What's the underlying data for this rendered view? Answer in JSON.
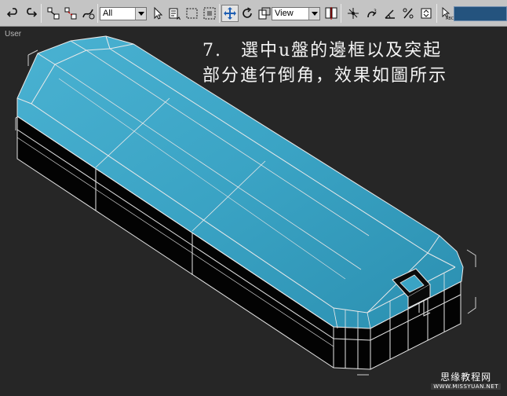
{
  "toolbar": {
    "selection_filter": "All",
    "reference_coord": "View",
    "buttons": [
      {
        "name": "undo-icon",
        "interactable": true
      },
      {
        "name": "redo-icon",
        "interactable": true
      },
      {
        "name": "select-and-link-icon",
        "interactable": true
      },
      {
        "name": "unlink-selection-icon",
        "interactable": true
      },
      {
        "name": "bind-to-space-warp-icon",
        "interactable": true
      },
      {
        "name": "select-object-icon",
        "interactable": true
      },
      {
        "name": "select-by-name-icon",
        "interactable": true
      },
      {
        "name": "rectangular-selection-region-icon",
        "interactable": true
      },
      {
        "name": "window-crossing-icon",
        "interactable": true
      },
      {
        "name": "select-and-move-icon",
        "interactable": true
      },
      {
        "name": "select-and-rotate-icon",
        "interactable": true
      },
      {
        "name": "select-and-scale-icon",
        "interactable": true
      },
      {
        "name": "use-pivot-center-icon",
        "interactable": true
      },
      {
        "name": "select-and-manipulate-icon",
        "interactable": true
      },
      {
        "name": "snaps-toggle-icon",
        "interactable": true
      },
      {
        "name": "angle-snap-icon",
        "interactable": true
      },
      {
        "name": "percent-snap-icon",
        "interactable": true
      },
      {
        "name": "spinner-snap-icon",
        "interactable": true
      },
      {
        "name": "edit-named-selection-icon",
        "interactable": true
      }
    ]
  },
  "viewport": {
    "label": "User"
  },
  "caption": {
    "line1": "7.　選中u盤的邊框以及突起",
    "line2": "部分進行倒角，效果如圖所示"
  },
  "watermark": {
    "site_name": "思缘教程网",
    "url": "WWW.MISSYUAN.NET"
  },
  "colors": {
    "toolbar_bg": "#c4c4c4",
    "viewport_bg": "#262626",
    "model_top": "#3a9fc0",
    "model_top_light": "#5ab8d6",
    "model_side": "#050505",
    "wire": "#e8e8e8",
    "name_field": "#24537e"
  }
}
